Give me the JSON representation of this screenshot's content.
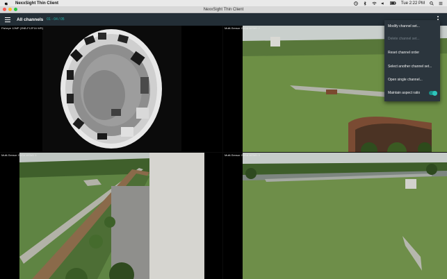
{
  "menubar": {
    "app_name": "NexxSight Thin Client",
    "clock": "Tue 2:22 PM"
  },
  "window": {
    "title": "NexxSight Thin Client"
  },
  "appbar": {
    "view_title": "All channels",
    "view_range": "01 - 04 / 05"
  },
  "tiles": [
    {
      "label": "Fisheye 12MP (2NB-F12F16 WR)"
    },
    {
      "label": "Multi-Sensor 2NGA WSM1 2"
    },
    {
      "label": "Multi-Sensor 2NGA WSM1 1"
    },
    {
      "label": "Multi-Sensor 2NGA WSM1 3"
    }
  ],
  "menu": {
    "items": [
      {
        "label": "Modify channel set...",
        "enabled": true
      },
      {
        "label": "Delete channel set...",
        "enabled": false
      },
      {
        "label": "Reset channel order",
        "enabled": true
      },
      {
        "label": "Select another channel set...",
        "enabled": true
      },
      {
        "label": "Open single channel...",
        "enabled": true
      },
      {
        "label": "Maintain aspect ratio",
        "enabled": true
      }
    ],
    "maintain_aspect_ratio": true
  },
  "colors": {
    "accent": "#1fb5ac",
    "appbar": "#232e36",
    "menu_bg": "#2b353d"
  }
}
